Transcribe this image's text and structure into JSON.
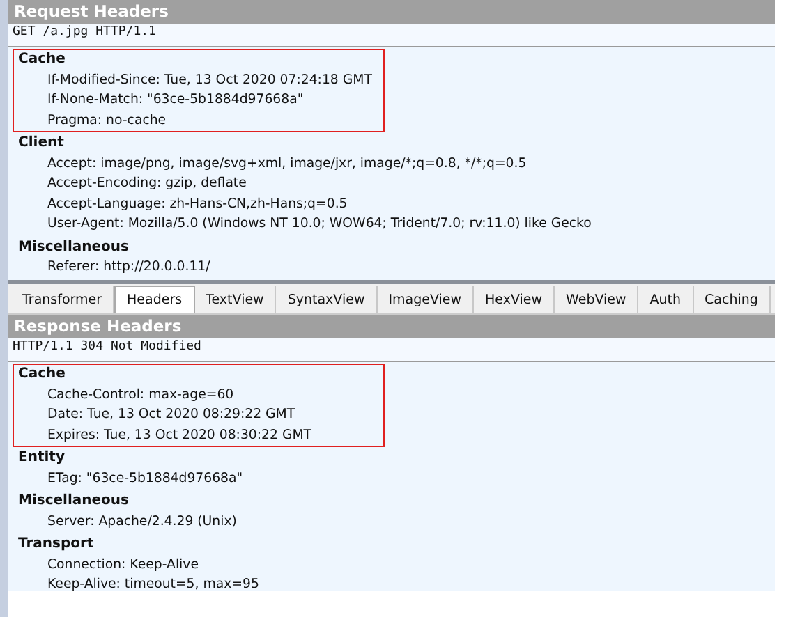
{
  "request": {
    "title": "Request Headers",
    "request_line": "GET /a.jpg HTTP/1.1",
    "groups": [
      {
        "name": "Cache",
        "highlighted": true,
        "headers": [
          "If-Modified-Since: Tue, 13 Oct 2020 07:24:18 GMT",
          "If-None-Match: \"63ce-5b1884d97668a\"",
          "Pragma: no-cache"
        ]
      },
      {
        "name": "Client",
        "highlighted": false,
        "headers": [
          "Accept: image/png, image/svg+xml, image/jxr, image/*;q=0.8, */*;q=0.5",
          "Accept-Encoding: gzip, deflate",
          "Accept-Language: zh-Hans-CN,zh-Hans;q=0.5",
          "User-Agent: Mozilla/5.0 (Windows NT 10.0; WOW64; Trident/7.0; rv:11.0) like Gecko"
        ]
      },
      {
        "name": "Miscellaneous",
        "highlighted": false,
        "headers": [
          "Referer: http://20.0.0.11/"
        ]
      }
    ]
  },
  "tabs": [
    {
      "label": "Transformer",
      "selected": false
    },
    {
      "label": "Headers",
      "selected": true
    },
    {
      "label": "TextView",
      "selected": false
    },
    {
      "label": "SyntaxView",
      "selected": false
    },
    {
      "label": "ImageView",
      "selected": false
    },
    {
      "label": "HexView",
      "selected": false
    },
    {
      "label": "WebView",
      "selected": false
    },
    {
      "label": "Auth",
      "selected": false
    },
    {
      "label": "Caching",
      "selected": false
    }
  ],
  "response": {
    "title": "Response Headers",
    "request_line": "HTTP/1.1 304 Not Modified",
    "groups": [
      {
        "name": "Cache",
        "highlighted": true,
        "headers": [
          "Cache-Control: max-age=60",
          "Date: Tue, 13 Oct 2020 08:29:22 GMT",
          "Expires: Tue, 13 Oct 2020 08:30:22 GMT"
        ]
      },
      {
        "name": "Entity",
        "highlighted": false,
        "headers": [
          "ETag: \"63ce-5b1884d97668a\""
        ]
      },
      {
        "name": "Miscellaneous",
        "highlighted": false,
        "headers": [
          "Server: Apache/2.4.29 (Unix)"
        ]
      },
      {
        "name": "Transport",
        "highlighted": false,
        "headers": [
          "Connection: Keep-Alive",
          "Keep-Alive: timeout=5, max=95"
        ]
      }
    ]
  }
}
